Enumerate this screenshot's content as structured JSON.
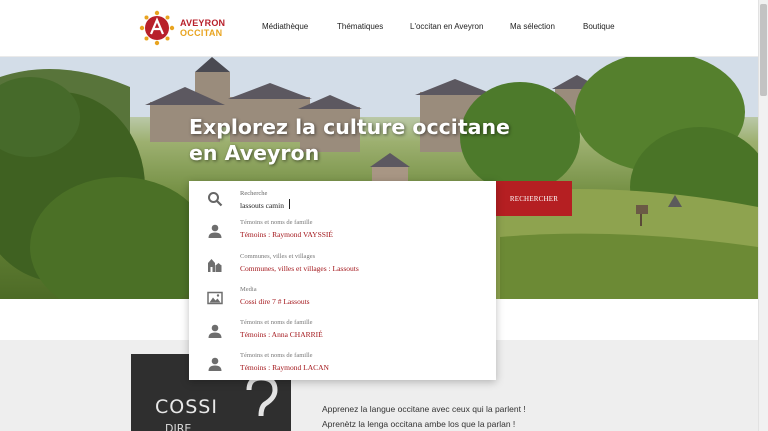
{
  "brand": {
    "line1": "AVEYRON",
    "line2": "OCCITAN",
    "red": "#b8202b",
    "gold": "#e8a420"
  },
  "nav": [
    {
      "label": "Médiathèque"
    },
    {
      "label": "Thématiques"
    },
    {
      "label": "L'occitan en Aveyron"
    },
    {
      "label": "Ma sélection"
    },
    {
      "label": "Boutique"
    }
  ],
  "hero": {
    "title_line1": "Explorez la culture occitane",
    "title_line2": "en Aveyron"
  },
  "search": {
    "label": "Recherche",
    "value": "lassouts camin",
    "button_label": "RECHERCHER",
    "accent": "#b51f22"
  },
  "suggestions": [
    {
      "category": "Témoins et noms de famille",
      "value": "Témoins : Raymond VAYSSIÉ",
      "icon": "person-icon"
    },
    {
      "category": "Communes, villes et villages",
      "value": "Communes, villes et villages : Lassouts",
      "icon": "village-icon"
    },
    {
      "category": "Media",
      "value": "Cossi dire 7 # Lassouts",
      "icon": "image-icon"
    },
    {
      "category": "Témoins et noms de famille",
      "value": "Témoins : Anna CHARRIÉ",
      "icon": "person-icon"
    },
    {
      "category": "Témoins et noms de famille",
      "value": "Témoins : Raymond LACAN",
      "icon": "person-icon"
    }
  ],
  "promo": {
    "image_text": "COSSI",
    "image_text2": "DIRE",
    "line1": "Apprenez la langue occitane avec ceux qui la parlent !",
    "line2": "Aprenètz la lenga occitana ambe los que la parlan !"
  }
}
